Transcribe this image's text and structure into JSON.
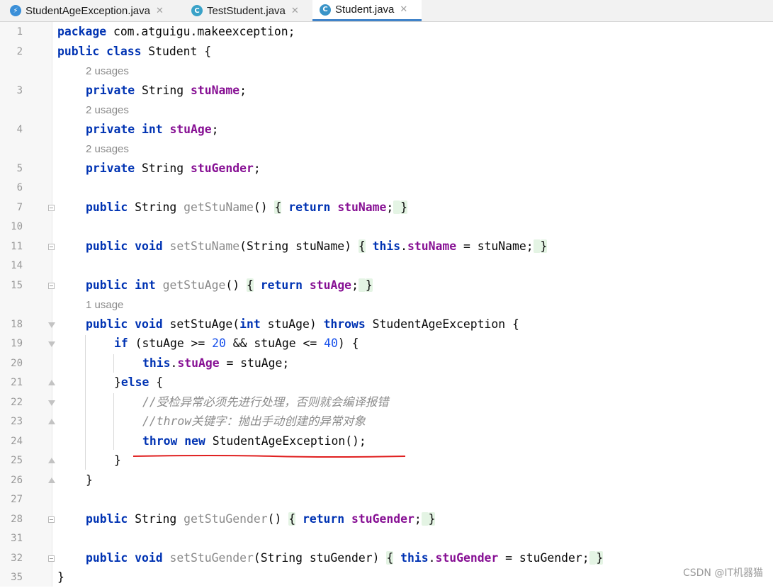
{
  "tabs": [
    {
      "label": "StudentAgeException.java",
      "icon": "exception-class-icon",
      "active": false
    },
    {
      "label": "TestStudent.java",
      "icon": "runnable-class-icon",
      "active": false
    },
    {
      "label": "Student.java",
      "icon": "class-icon",
      "active": true
    }
  ],
  "tab_icon_letter": "C",
  "close_glyph": "✕",
  "lines": {
    "l1": {
      "num": "1",
      "t": [
        "package",
        " com.atguigu.makeexception;"
      ]
    },
    "l2": {
      "num": "2",
      "t": [
        "public",
        " ",
        "class",
        " Student {"
      ]
    },
    "h1": "2 usages",
    "l3": {
      "num": "3",
      "t": [
        "private",
        " String ",
        "stuName",
        ";"
      ]
    },
    "h2": "2 usages",
    "l4": {
      "num": "4",
      "t": [
        "private",
        " ",
        "int",
        " ",
        "stuAge",
        ";"
      ]
    },
    "h3": "2 usages",
    "l5": {
      "num": "5",
      "t": [
        "private",
        " String ",
        "stuGender",
        ";"
      ]
    },
    "l6": {
      "num": "6"
    },
    "l7": {
      "num": "7",
      "t": [
        "public",
        " String ",
        "getStuName",
        "() ",
        "{",
        " ",
        "return",
        " ",
        "stuName",
        ";",
        " ",
        "}"
      ]
    },
    "l10": {
      "num": "10"
    },
    "l11": {
      "num": "11",
      "t": [
        "public",
        " ",
        "void",
        " ",
        "setStuName",
        "(String stuName) ",
        "{",
        " ",
        "this",
        ".",
        "stuName",
        " = stuName;",
        " ",
        "}"
      ]
    },
    "l14": {
      "num": "14"
    },
    "l15": {
      "num": "15",
      "t": [
        "public",
        " ",
        "int",
        " ",
        "getStuAge",
        "() ",
        "{",
        " ",
        "return",
        " ",
        "stuAge",
        ";",
        " ",
        "}"
      ]
    },
    "h4": "1 usage",
    "l18": {
      "num": "18",
      "t": [
        "public",
        " ",
        "void",
        " setStuAge(",
        "int",
        " stuAge) ",
        "throws",
        " StudentAgeException {"
      ]
    },
    "l19": {
      "num": "19",
      "t": [
        "if",
        " (stuAge >= ",
        "20",
        " && stuAge <= ",
        "40",
        ") {"
      ]
    },
    "l20": {
      "num": "20",
      "t": [
        "this",
        ".",
        "stuAge",
        " = stuAge;"
      ]
    },
    "l21": {
      "num": "21",
      "t": [
        "}",
        "else",
        " {"
      ]
    },
    "l22": {
      "num": "22",
      "t": [
        "//受检异常必须先进行处理，否则就会编译报错"
      ]
    },
    "l23": {
      "num": "23",
      "t": [
        "//throw关键字：抛出手动创建的异常对象"
      ]
    },
    "l24": {
      "num": "24",
      "t": [
        "throw",
        " ",
        "new",
        " StudentAgeException();"
      ]
    },
    "l25": {
      "num": "25",
      "t": [
        "}"
      ]
    },
    "l26": {
      "num": "26",
      "t": [
        "}"
      ]
    },
    "l27": {
      "num": "27"
    },
    "l28": {
      "num": "28",
      "t": [
        "public",
        " String ",
        "getStuGender",
        "() ",
        "{",
        " ",
        "return",
        " ",
        "stuGender",
        ";",
        " ",
        "}"
      ]
    },
    "l31": {
      "num": "31"
    },
    "l32": {
      "num": "32",
      "t": [
        "public",
        " ",
        "void",
        " ",
        "setStuGender",
        "(String stuGender) ",
        "{",
        " ",
        "this",
        ".",
        "stuGender",
        " = stuGender;",
        " ",
        "}"
      ]
    },
    "l35": {
      "num": "35",
      "t": [
        "}"
      ]
    }
  },
  "colors": {
    "keyword": "#0033b3",
    "field": "#871094",
    "number": "#1750eb",
    "comment": "#8c8c8c",
    "underline": "#e02020",
    "tab_active": "#4083c9"
  },
  "watermark": "CSDN @IT机器猫"
}
